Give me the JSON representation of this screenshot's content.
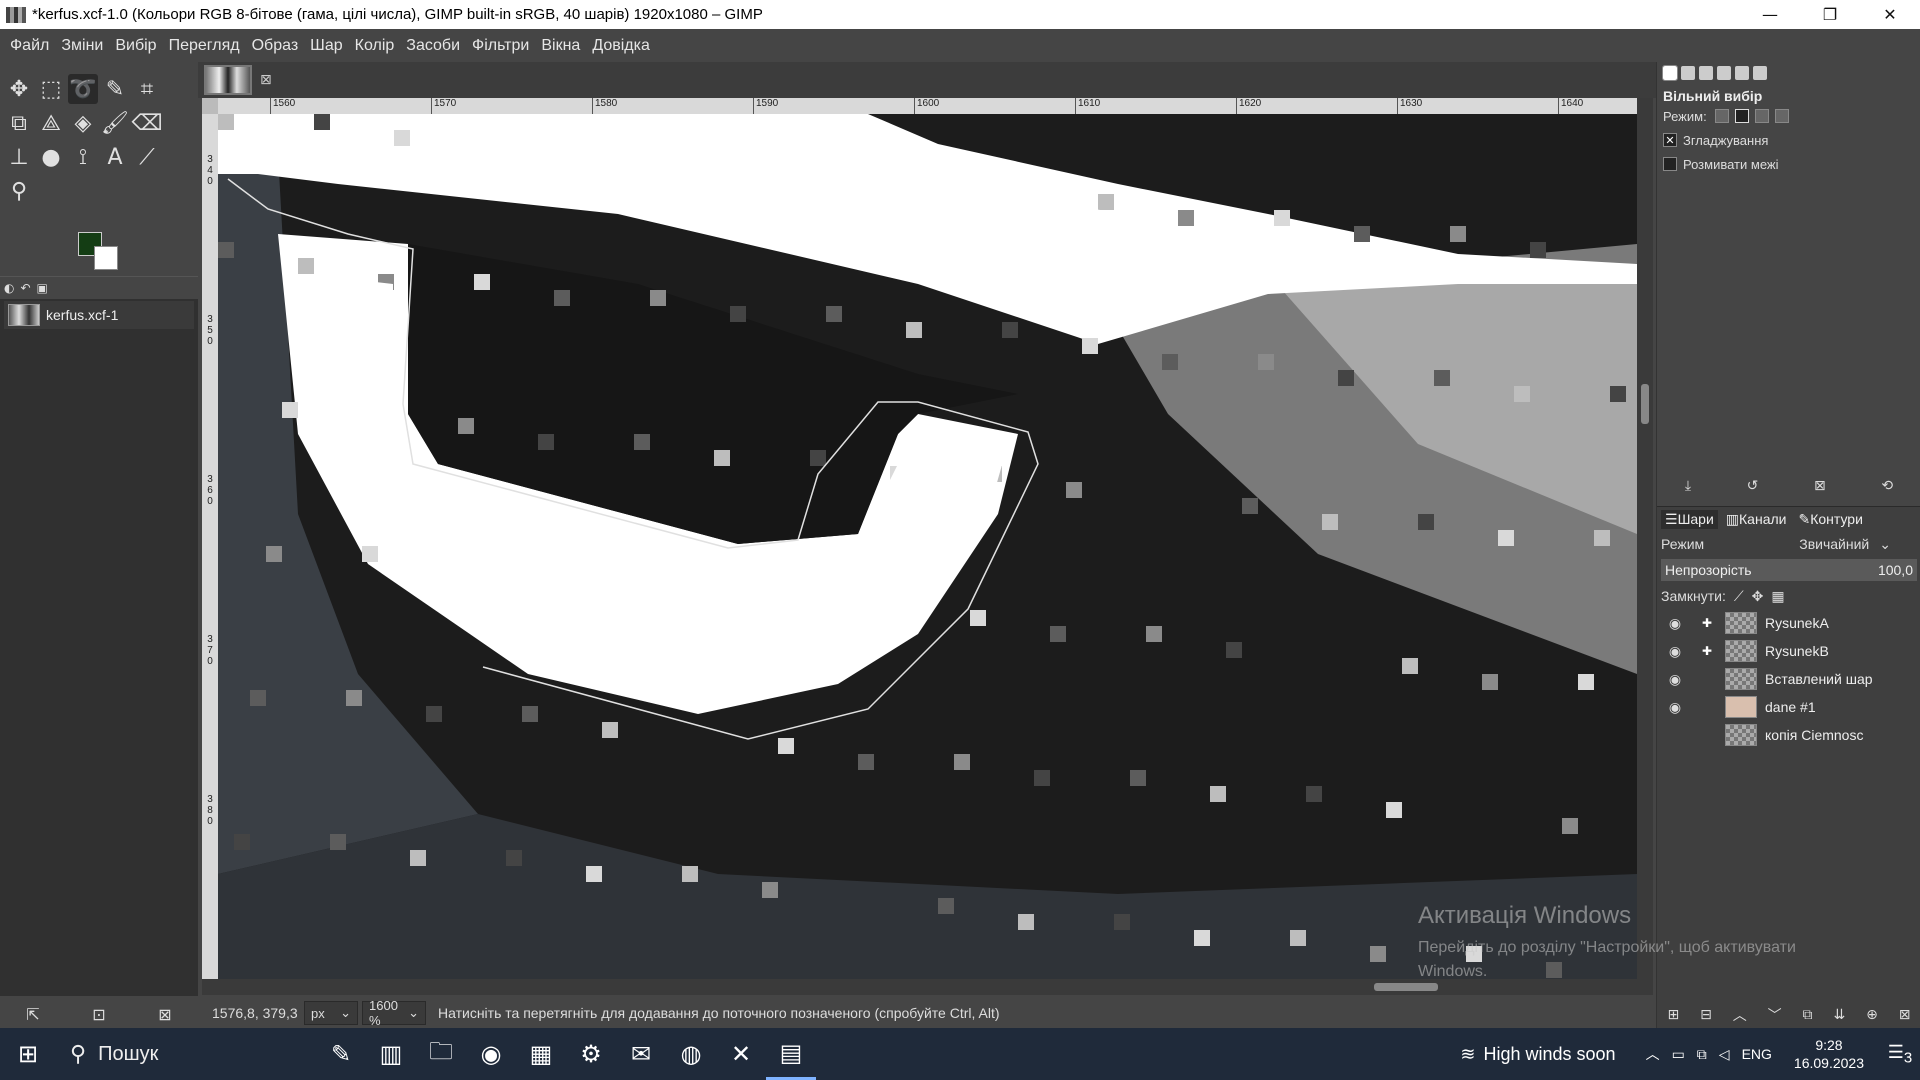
{
  "window": {
    "title": "*kerfus.xcf-1.0 (Кольори RGB 8-бітове (гама, цілі числа), GIMP built-in sRGB, 40 шарів) 1920x1080 – GIMP",
    "minimize": "—",
    "maximize": "❐",
    "close": "✕"
  },
  "menu": [
    "Файл",
    "Зміни",
    "Вибір",
    "Перегляд",
    "Образ",
    "Шар",
    "Колір",
    "Засоби",
    "Фільтри",
    "Вікна",
    "Довідка"
  ],
  "toolbox": {
    "tools": [
      {
        "name": "move-tool-icon",
        "glyph": "✥"
      },
      {
        "name": "rect-select-tool-icon",
        "glyph": "⬚"
      },
      {
        "name": "free-select-tool-icon",
        "glyph": "➰",
        "active": true
      },
      {
        "name": "fuzzy-select-tool-icon",
        "glyph": "✎"
      },
      {
        "name": "crop-tool-icon",
        "glyph": "⌗"
      },
      {
        "name": "unified-transform-tool-icon",
        "glyph": "⧉"
      },
      {
        "name": "warp-transform-tool-icon",
        "glyph": "⟁"
      },
      {
        "name": "bucket-fill-tool-icon",
        "glyph": "◈"
      },
      {
        "name": "paintbrush-tool-icon",
        "glyph": "🖌"
      },
      {
        "name": "eraser-tool-icon",
        "glyph": "⌫"
      },
      {
        "name": "clone-tool-icon",
        "glyph": "⊥"
      },
      {
        "name": "smudge-tool-icon",
        "glyph": "●"
      },
      {
        "name": "paths-tool-icon",
        "glyph": "⟟"
      },
      {
        "name": "text-tool-icon",
        "glyph": "A"
      },
      {
        "name": "color-picker-tool-icon",
        "glyph": "⟋"
      },
      {
        "name": "zoom-tool-icon",
        "glyph": "⚲"
      }
    ],
    "fg_color": "#143d14",
    "bg_color": "#ffffff"
  },
  "images_dock": {
    "items": [
      {
        "label": "kerfus.xcf-1"
      }
    ]
  },
  "image_tab": {
    "close": "⊠"
  },
  "ruler": {
    "top_labels": [
      "1560",
      "1570",
      "1580",
      "1590",
      "1600",
      "1610",
      "1620",
      "1630",
      "1640"
    ],
    "left_labels": [
      "340",
      "350",
      "360",
      "370",
      "380"
    ]
  },
  "status": {
    "coords": "1576,8, 379,3",
    "unit": "px",
    "zoom": "1600 %",
    "hint": "Натисніть та перетягніть для додавання до поточного позначеного (спробуйте Ctrl, Alt)"
  },
  "tool_options": {
    "title": "Вільний вибір",
    "mode_label": "Режим:",
    "antialias_label": "Згладжування",
    "antialias_checked": true,
    "feather_label": "Розмивати межі",
    "feather_checked": false
  },
  "layers": {
    "tabs": [
      "Шари",
      "Канали",
      "Контури"
    ],
    "mode_label": "Режим",
    "mode_value": "Звичайний",
    "opacity_label": "Непрозорість",
    "opacity_value": "100,0",
    "lock_label": "Замкнути:",
    "items": [
      {
        "name": "RysunekA",
        "chain": true,
        "skin": false
      },
      {
        "name": "RysunekB",
        "chain": true,
        "skin": false
      },
      {
        "name": "Вставлений шар",
        "chain": false,
        "skin": false
      },
      {
        "name": "dane #1",
        "chain": false,
        "skin": true
      },
      {
        "name": "копія Ciemnosc",
        "chain": false,
        "skin": false,
        "hidden": true
      }
    ]
  },
  "activation": {
    "line1": "Активація Windows",
    "line2": "Перейдіть до розділу \"Настройки\", щоб активувати",
    "line3": "Windows."
  },
  "taskbar": {
    "search": "Пошук",
    "weather": "High winds soon",
    "lang": "ENG",
    "time": "9:28",
    "date": "16.09.2023",
    "notifications": "3"
  }
}
